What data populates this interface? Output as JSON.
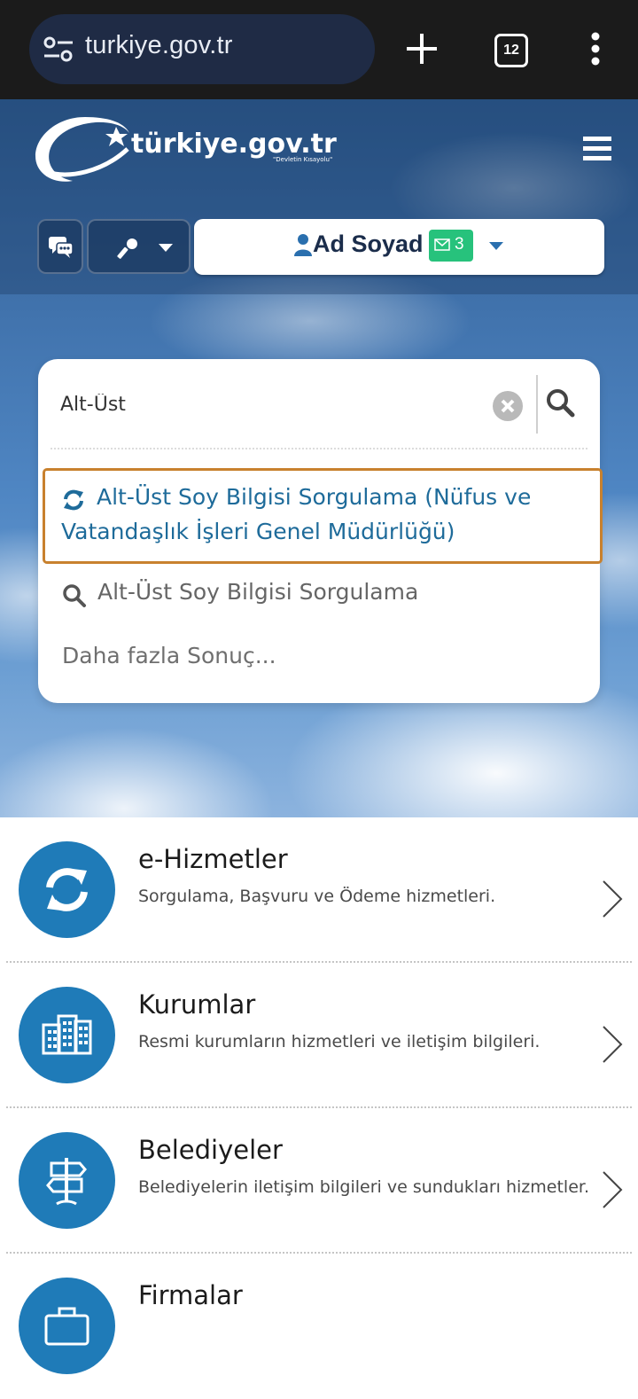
{
  "browser": {
    "url": "turkiye.gov.tr",
    "tabs_count": "12"
  },
  "header": {
    "logo_text": "türkiye.gov.tr",
    "logo_tagline": "\"Devletin Kısayolu\"",
    "user_name": "Ad Soyad",
    "mail_count": "3"
  },
  "search": {
    "value": "Alt-Üst",
    "results": [
      {
        "label": "Alt-Üst Soy Bilgisi Sorgulama (Nüfus ve Vatandaşlık İşleri Genel Müdürlüğü)",
        "icon": "refresh-icon"
      },
      {
        "label": "Alt-Üst Soy Bilgisi Sorgulama",
        "icon": "search-icon"
      }
    ],
    "more_label": "Daha fazla Sonuç..."
  },
  "sections": [
    {
      "title": "e-Hizmetler",
      "desc": "Sorgulama, Başvuru ve Ödeme hizmetleri.",
      "icon": "refresh-icon"
    },
    {
      "title": "Kurumlar",
      "desc": "Resmi kurumların hizmetleri ve iletişim bilgileri.",
      "icon": "building-icon"
    },
    {
      "title": "Belediyeler",
      "desc": "Belediyelerin iletişim bilgileri ve sundukları hizmetler.",
      "icon": "signpost-icon"
    },
    {
      "title": "Firmalar",
      "desc": "",
      "icon": "briefcase-icon"
    }
  ],
  "colors": {
    "accent_blue": "#1f7bb8",
    "result_text": "#1e6b9a",
    "highlight_border": "#c8812e",
    "badge_green": "#27c27c",
    "chrome_bg": "#1b1b1b"
  }
}
